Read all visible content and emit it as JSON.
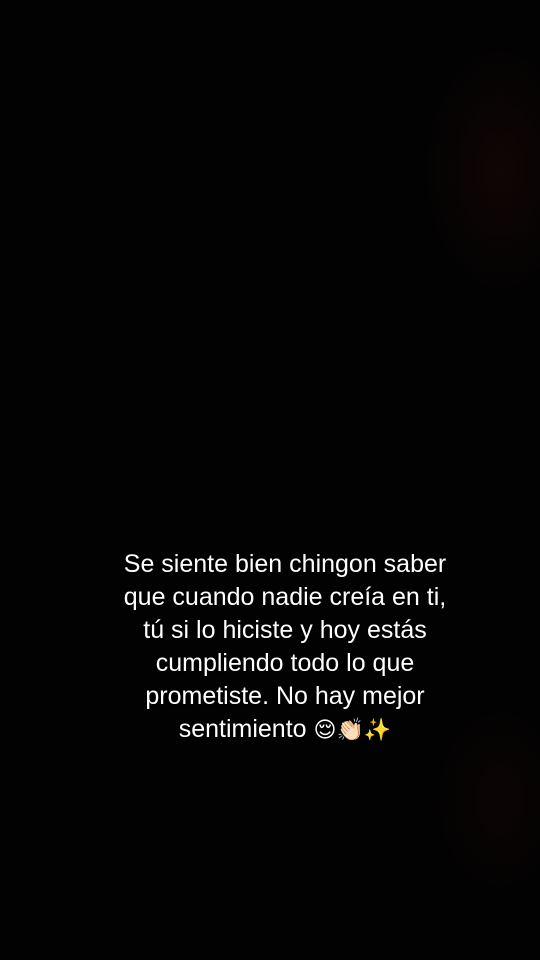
{
  "caption": {
    "lines": [
      "Se siente bien chingon saber",
      "que cuando nadie creía en ti,",
      "tú si lo hiciste y hoy estás",
      "cumpliendo todo lo que",
      "prometiste. No hay mejor",
      "sentimiento"
    ],
    "emojis": "😌👏🏻✨"
  }
}
